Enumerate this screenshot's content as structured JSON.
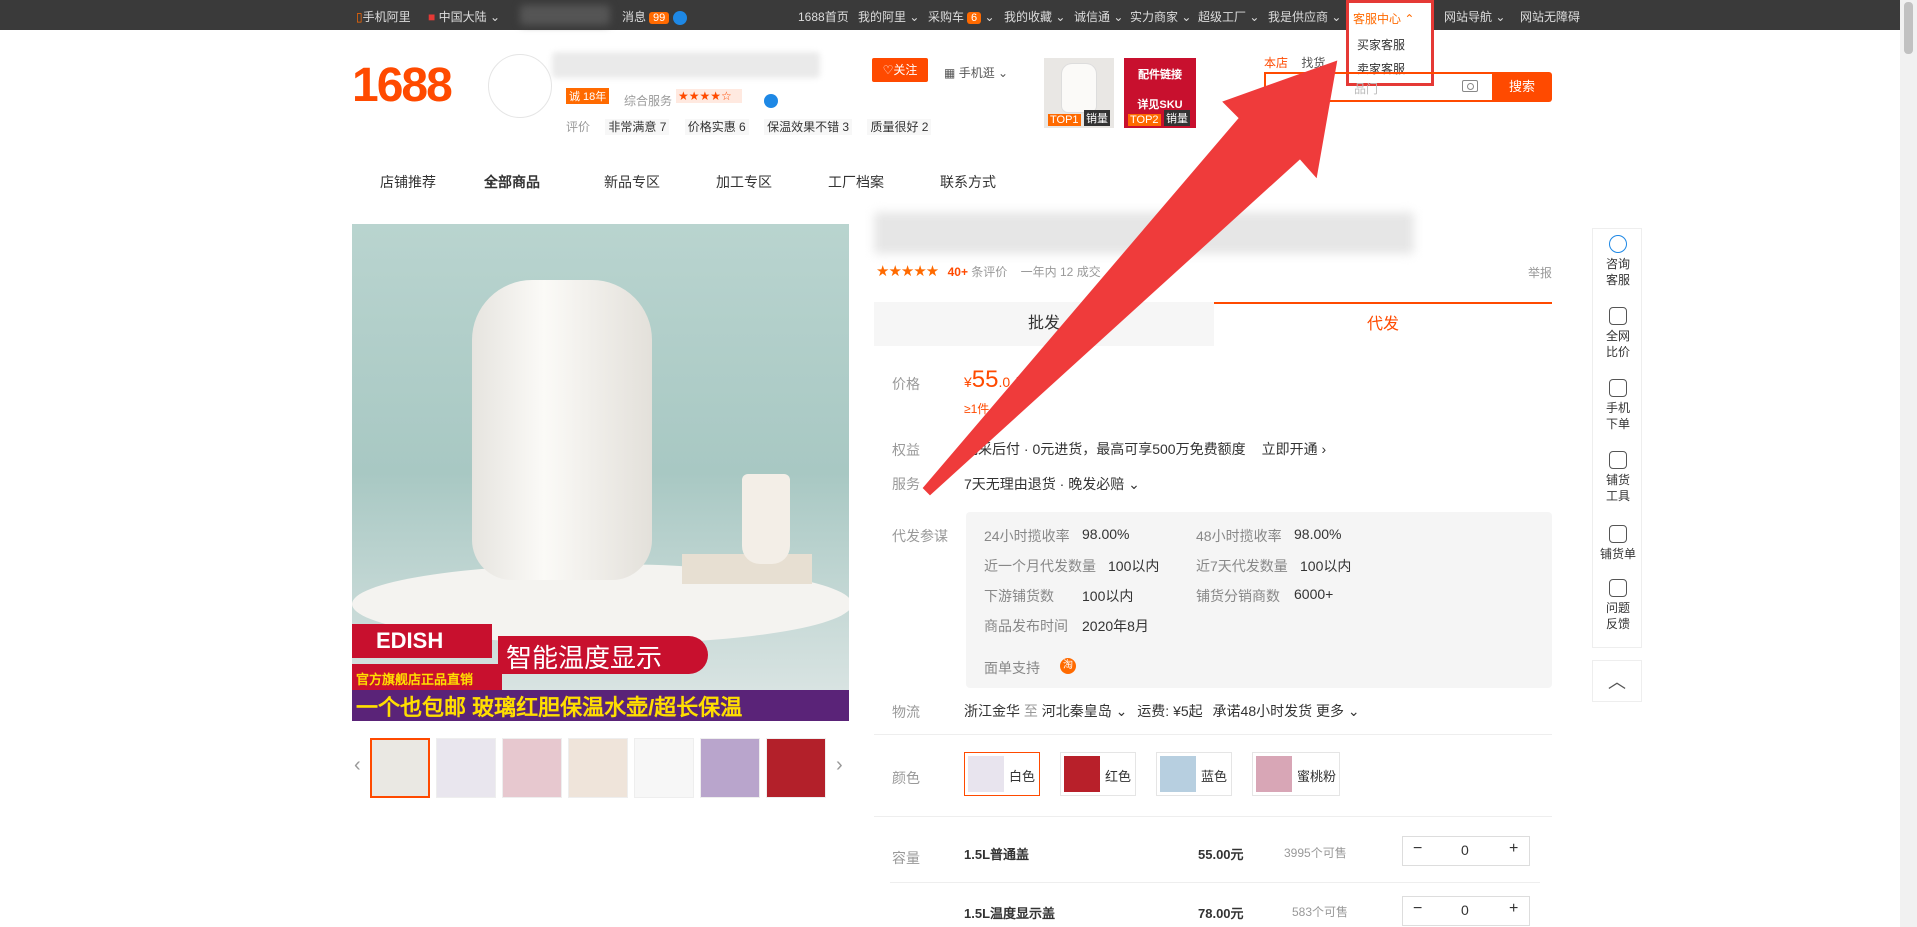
{
  "topbar": {
    "mobile_alibaba": "手机阿里",
    "region": "中国大陆",
    "messages": "消息",
    "messages_count": "99",
    "home": "1688首页",
    "my_alibaba": "我的阿里",
    "cart": "采购车",
    "cart_count": "6",
    "favorites": "我的收藏",
    "chengxintong": "诚信通",
    "strong_merchant": "实力商家",
    "super_factory": "超级工厂",
    "supplier": "我是供应商",
    "service_center": "客服中心",
    "site_nav": "网站导航",
    "accessibility": "网站无障碍"
  },
  "service_menu": {
    "buyer": "买家客服",
    "seller": "卖家客服"
  },
  "header": {
    "logo": "1688",
    "year_badge": "诚 18年",
    "service_label": "综合服务",
    "stars": "★★★★☆",
    "follow": "关注",
    "mobile_view": "手机逛",
    "review_label": "评价",
    "review_tags": [
      "非常满意 7",
      "价格实惠 6",
      "保温效果不错 3",
      "质量很好 2"
    ],
    "promo1_rank": "TOP1",
    "promo1_sales": "销量",
    "promo2_title": "配件链接",
    "promo2_sub": "详见SKU",
    "promo2_rank": "TOP2",
    "promo2_sales": "销量",
    "search_tab_shop": "本店",
    "search_tab_other": "找货",
    "search_placeholder": "品门",
    "search_button": "搜索"
  },
  "nav": {
    "items": [
      "店铺推荐",
      "全部商品",
      "新品专区",
      "加工专区",
      "工厂档案",
      "联系方式"
    ]
  },
  "product_image": {
    "brand": "EDISH",
    "slogan": "智能温度显示",
    "sub": "官方旗舰店正品直销",
    "bottom": "一个也包邮 玻璃红胆保温水壶/超长保温"
  },
  "product": {
    "rating_stars": "★★★★★",
    "review_count": "40+",
    "review_text": "条评价",
    "year_sales": "一年内 12",
    "year_sales_tail": "成交",
    "report": "举报",
    "tab_wholesale": "批发",
    "tab_dropship": "代发",
    "price_label": "价格",
    "price_symbol": "¥",
    "price_value": "55",
    "price_unit": ".0 /起",
    "min_qty": "≥1件",
    "benefit_label": "权益",
    "benefit_text": "先采后付 · 0元进货，最高可享500万免费额度",
    "benefit_link": "立即开通",
    "service_label": "服务",
    "service_text": "7天无理由退货 · 晚发必赔",
    "ref_label": "代发参谋",
    "ref": {
      "k1": "24小时揽收率",
      "v1": "98.00%",
      "k2": "48小时揽收率",
      "v2": "98.00%",
      "k3": "近一个月代发数量",
      "v3": "100以内",
      "k4": "近7天代发数量",
      "v4": "100以内",
      "k5": "下游铺货数",
      "v5": "100以内",
      "k6": "铺货分销商数",
      "v6": "6000+",
      "k7": "商品发布时间",
      "v7": "2020年8月",
      "k8": "面单支持"
    },
    "logistics_label": "物流",
    "logistics_from": "浙江金华",
    "logistics_to_word": "至",
    "logistics_to": "河北秦皇岛",
    "shipping": "运费: ¥5起",
    "promise": "承诺48小时发货",
    "more": "更多",
    "color_label": "颜色",
    "colors": [
      "白色",
      "红色",
      "蓝色",
      "蜜桃粉"
    ],
    "capacity_label": "容量",
    "specs": [
      {
        "name": "1.5L普通盖",
        "price": "55.00元",
        "stock": "3995个可售",
        "qty": "0"
      },
      {
        "name": "1.5L温度显示盖",
        "price": "78.00元",
        "stock": "583个可售",
        "qty": "0"
      }
    ]
  },
  "float_bar": {
    "items": [
      "咨询客服",
      "全网比价",
      "手机下单",
      "铺货工具",
      "铺货单",
      "问题反馈"
    ]
  },
  "colors": {
    "accent": "#ff4a00",
    "annotation": "#e53935"
  }
}
